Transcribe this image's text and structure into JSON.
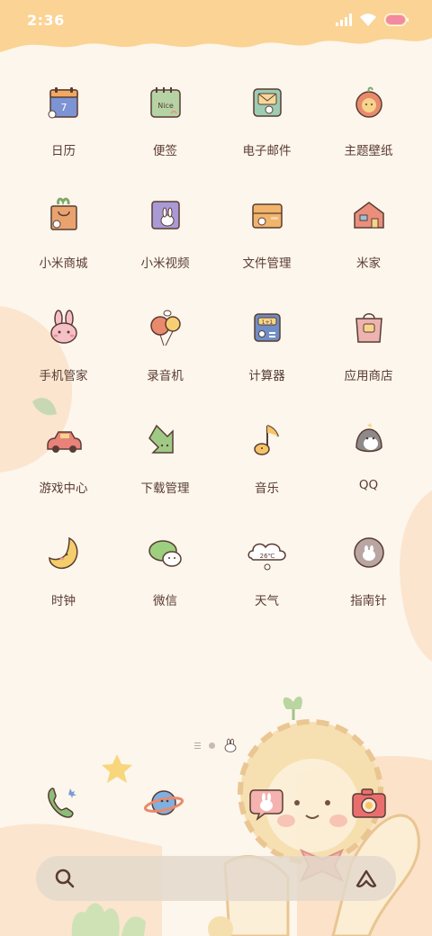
{
  "status_bar": {
    "time": "2:36",
    "icons": [
      "signal-icon",
      "wifi-icon",
      "battery-icon"
    ]
  },
  "apps": [
    {
      "label": "日历",
      "icon": "calendar-icon",
      "icon_text": "7"
    },
    {
      "label": "便签",
      "icon": "notes-icon",
      "icon_text": "Nice"
    },
    {
      "label": "电子邮件",
      "icon": "email-icon"
    },
    {
      "label": "主题壁纸",
      "icon": "themes-icon"
    },
    {
      "label": "小米商城",
      "icon": "shopping-bag-icon"
    },
    {
      "label": "小米视频",
      "icon": "video-icon"
    },
    {
      "label": "文件管理",
      "icon": "folder-icon"
    },
    {
      "label": "米家",
      "icon": "house-icon"
    },
    {
      "label": "手机管家",
      "icon": "bunny-icon"
    },
    {
      "label": "录音机",
      "icon": "balloons-icon"
    },
    {
      "label": "计算器",
      "icon": "calculator-icon",
      "icon_text": "1+1"
    },
    {
      "label": "应用商店",
      "icon": "store-bag-icon"
    },
    {
      "label": "游戏中心",
      "icon": "car-icon"
    },
    {
      "label": "下载管理",
      "icon": "download-arrow-icon"
    },
    {
      "label": "音乐",
      "icon": "music-note-icon"
    },
    {
      "label": "QQ",
      "icon": "penguin-icon"
    },
    {
      "label": "时钟",
      "icon": "moon-clock-icon"
    },
    {
      "label": "微信",
      "icon": "chat-bubbles-icon"
    },
    {
      "label": "天气",
      "icon": "weather-cloud-icon",
      "icon_text": "26℃"
    },
    {
      "label": "指南针",
      "icon": "compass-icon"
    }
  ],
  "page_indicator": {
    "pages": 2,
    "current": 2
  },
  "dock": [
    {
      "name": "phone",
      "icon": "phone-icon"
    },
    {
      "name": "browser",
      "icon": "planet-icon"
    },
    {
      "name": "messages",
      "icon": "bunny-message-icon"
    },
    {
      "name": "camera",
      "icon": "camera-icon"
    }
  ],
  "search": {
    "search_icon": "search-icon",
    "assistant_icon": "assistant-icon"
  },
  "colors": {
    "background": "#fdf6ec",
    "header_wave": "#fad08f",
    "text": "#5a3c33",
    "accent_orange": "#f0a15f",
    "search_bar": "#e2d8cb"
  }
}
